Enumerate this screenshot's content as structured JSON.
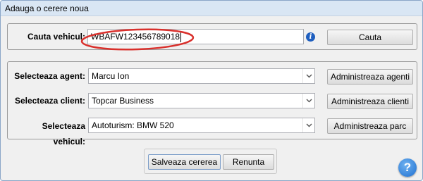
{
  "window": {
    "title": "Adauga o cerere noua"
  },
  "search": {
    "label": "Cauta vehicul:",
    "value": "WBAFW123456789018",
    "button_label": "Cauta",
    "info_glyph": "i"
  },
  "form": {
    "agent": {
      "label": "Selecteaza agent:",
      "value": "Marcu Ion",
      "manage_label": "Administreaza agenti"
    },
    "client": {
      "label": "Selecteaza client:",
      "value": "Topcar Business",
      "manage_label": "Administreaza clienti"
    },
    "vehicle": {
      "label": "Selecteaza vehicul:",
      "value": "Autoturism: BMW 520",
      "manage_label": "Administreaza parc"
    }
  },
  "actions": {
    "save_label": "Salveaza cererea",
    "cancel_label": "Renunta"
  },
  "help": {
    "glyph": "?"
  },
  "colors": {
    "highlight": "#d9302c",
    "info": "#1f5fbf",
    "help": "#1f6fd1",
    "titlebar": "#d9e6f4"
  }
}
